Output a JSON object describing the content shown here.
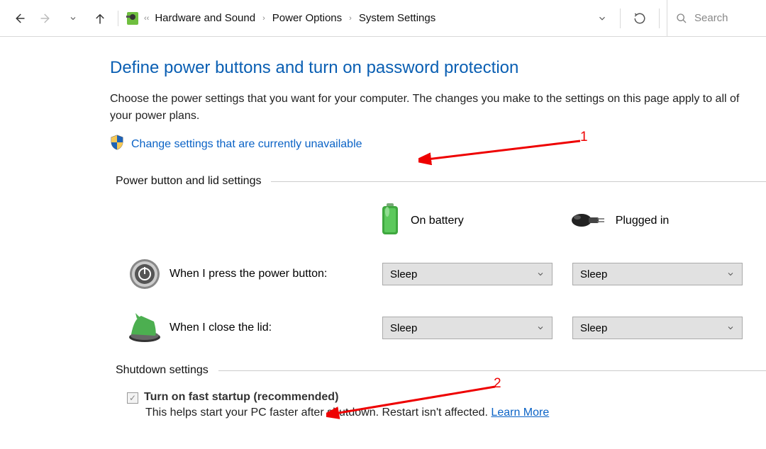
{
  "breadcrumb": {
    "items": [
      "Hardware and Sound",
      "Power Options",
      "System Settings"
    ]
  },
  "search": {
    "placeholder": "Search"
  },
  "page": {
    "title": "Define power buttons and turn on password protection",
    "description": "Choose the power settings that you want for your computer. The changes you make to the settings on this page apply to all of your power plans.",
    "change_link": "Change settings that are currently unavailable"
  },
  "sections": {
    "power_button_header": "Power button and lid settings",
    "col_battery": "On battery",
    "col_plugged": "Plugged in",
    "row_power_button": "When I press the power button:",
    "row_close_lid": "When I close the lid:",
    "select_value": "Sleep",
    "shutdown_header": "Shutdown settings",
    "fast_startup_label": "Turn on fast startup (recommended)",
    "fast_startup_desc": "This helps start your PC faster after shutdown. Restart isn't affected. ",
    "learn_more": "Learn More"
  },
  "annotations": {
    "one": "1",
    "two": "2"
  }
}
